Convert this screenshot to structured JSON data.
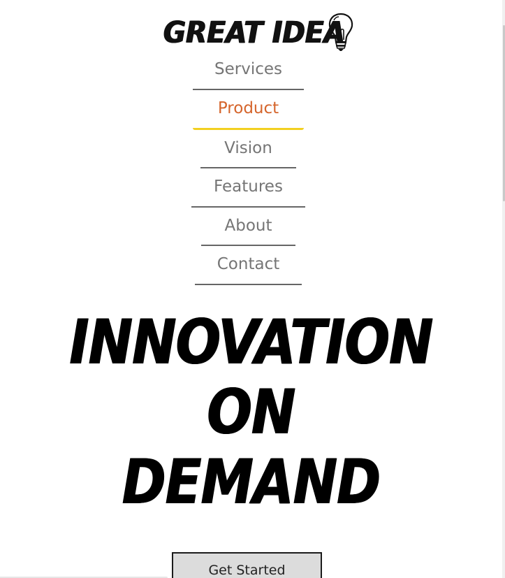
{
  "logo": {
    "text": "GREAT IDEA",
    "icon": "lightbulb-icon"
  },
  "nav": {
    "items": [
      {
        "label": "Services",
        "active": false
      },
      {
        "label": "Product",
        "active": true
      },
      {
        "label": "Vision",
        "active": false
      },
      {
        "label": "Features",
        "active": false
      },
      {
        "label": "About",
        "active": false
      },
      {
        "label": "Contact",
        "active": false
      }
    ],
    "colors": {
      "text": "#757575",
      "active_text": "#d5652c",
      "underline": "#666666",
      "active_underline": "#f2d021"
    }
  },
  "hero": {
    "lines": [
      "INNOVATION",
      "ON",
      "DEMAND"
    ]
  },
  "cta": {
    "label": "Get Started"
  }
}
